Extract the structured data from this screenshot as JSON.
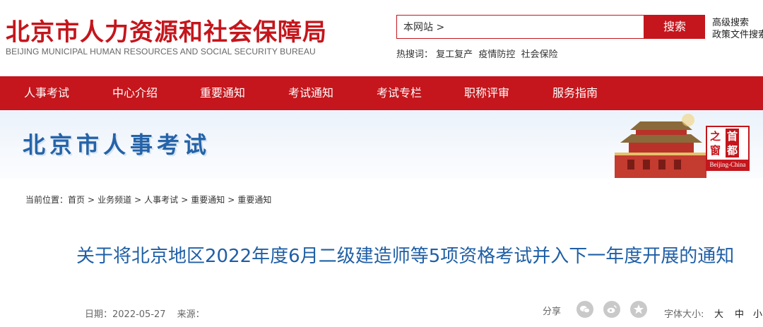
{
  "header": {
    "title": "北京市人力资源和社会保障局",
    "subtitle": "BEIJING MUNICIPAL HUMAN RESOURCES AND SOCIAL SECURITY BUREAU",
    "search": {
      "scope": "本网站 >",
      "button": "搜索",
      "advanced": "高级搜索",
      "policy": "政策文件搜索",
      "hot_label": "热搜词：",
      "hot_words": [
        "复工复产",
        "疫情防控",
        "社会保险"
      ]
    }
  },
  "nav": {
    "items": [
      "人事考试",
      "中心介绍",
      "重要通知",
      "考试通知",
      "考试专栏",
      "职称评审",
      "服务指南"
    ]
  },
  "banner": {
    "title": "北京市人事考试",
    "seal": {
      "chars": [
        "之",
        "首",
        "窗",
        "都"
      ],
      "caption": "Beijing-China"
    }
  },
  "breadcrumb": {
    "label": "当前位置：",
    "items": [
      "首页",
      "业务频道",
      "人事考试",
      "重要通知",
      "重要通知"
    ],
    "separator": ">"
  },
  "article": {
    "title": "关于将北京地区2022年度6月二级建造师等5项资格考试并入下一年度开展的通知",
    "date_label": "日期：",
    "date": "2022-05-27",
    "source_label": "来源："
  },
  "share": {
    "label": "分享",
    "icons": [
      "wechat-icon",
      "weibo-icon",
      "qzone-icon"
    ]
  },
  "font_size": {
    "label": "字体大小:",
    "options": [
      "大",
      "中",
      "小"
    ]
  },
  "colors": {
    "brand_red": "#c4161c",
    "title_blue": "#1f5fa6",
    "banner_blue": "#2563a8"
  }
}
